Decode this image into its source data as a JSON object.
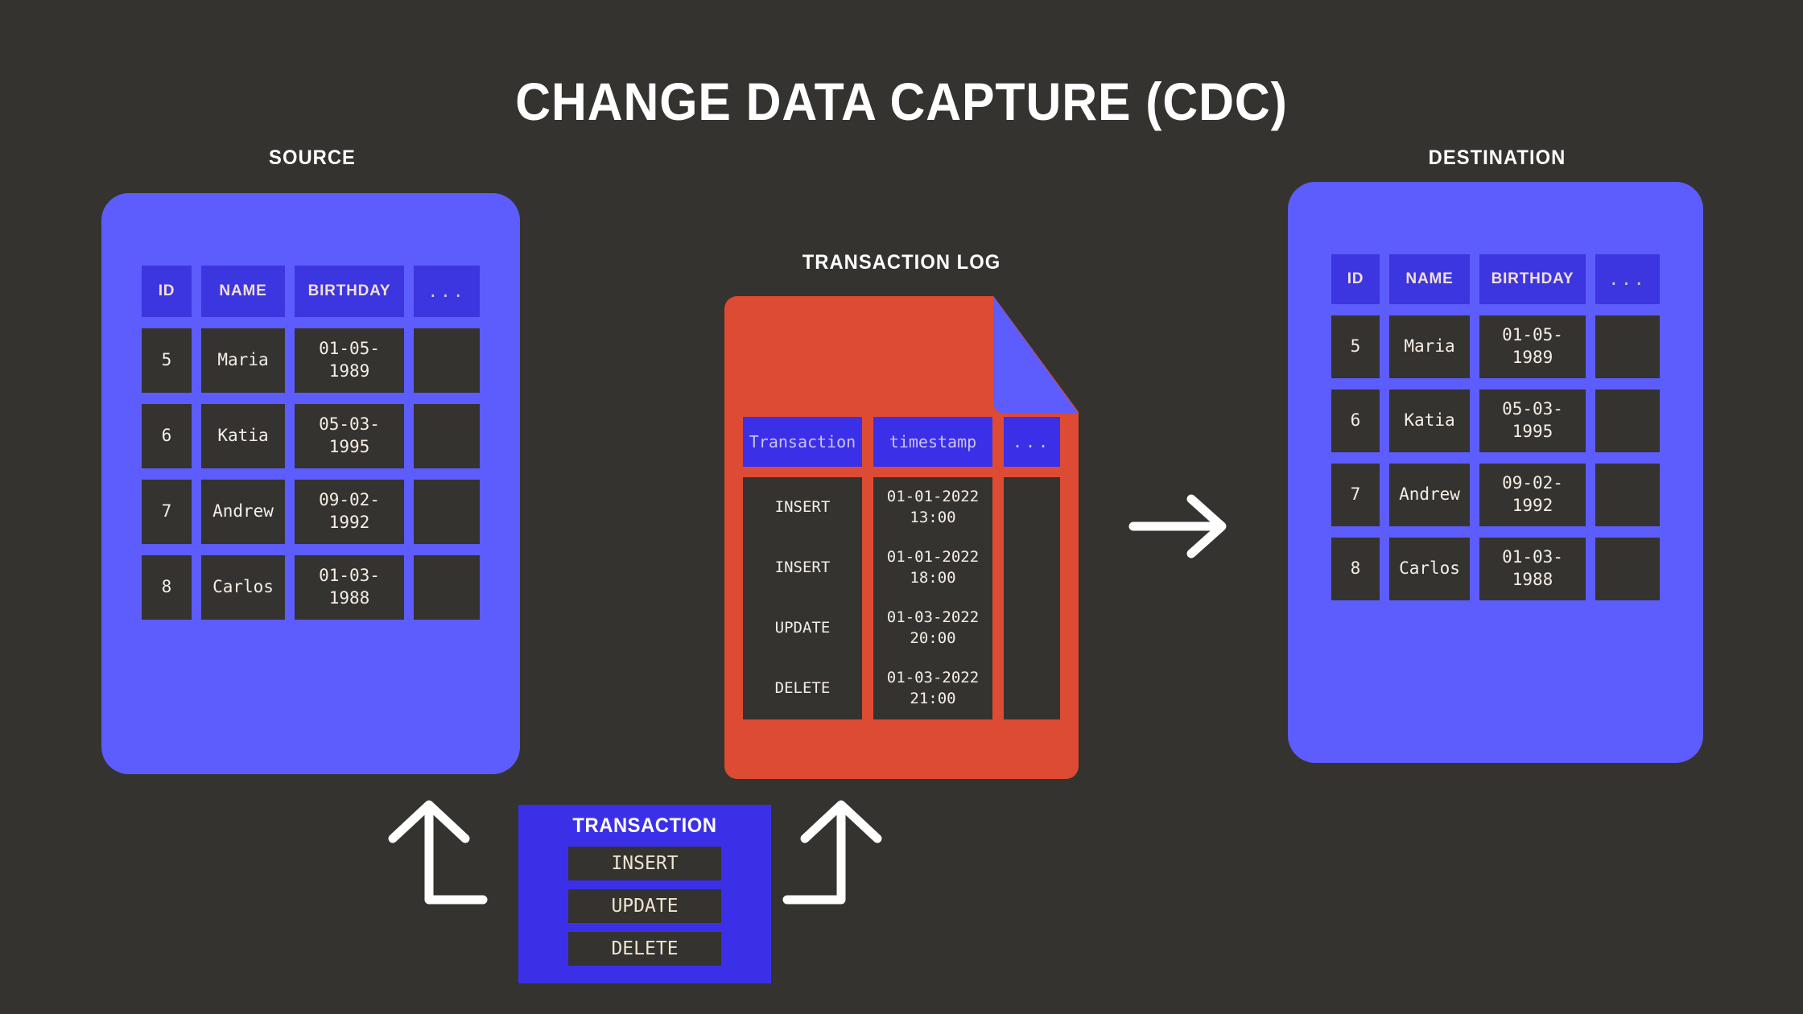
{
  "title": "CHANGE DATA CAPTURE (CDC)",
  "captions": {
    "source": "SOURCE",
    "destination": "DESTINATION",
    "log": "TRANSACTION LOG"
  },
  "db_table": {
    "headers": [
      "ID",
      "NAME",
      "BIRTHDAY",
      "..."
    ],
    "rows": [
      [
        "5",
        "Maria",
        "01-05-\n1989",
        ""
      ],
      [
        "6",
        "Katia",
        "05-03-\n1995",
        ""
      ],
      [
        "7",
        "Andrew",
        "09-02-\n1992",
        ""
      ],
      [
        "8",
        "Carlos",
        "01-03-\n1988",
        ""
      ]
    ]
  },
  "log_table": {
    "headers": [
      "Transaction",
      "timestamp",
      "..."
    ],
    "rows": [
      [
        "INSERT",
        "01-01-2022\n13:00",
        ""
      ],
      [
        "INSERT",
        "01-01-2022\n18:00",
        ""
      ],
      [
        "UPDATE",
        "01-03-2022\n20:00",
        ""
      ],
      [
        "DELETE",
        "01-03-2022\n21:00",
        ""
      ]
    ]
  },
  "transaction_panel": {
    "title": "TRANSACTION",
    "buttons": [
      "INSERT",
      "UPDATE",
      "DELETE"
    ]
  },
  "colors": {
    "background": "#34332f",
    "card_purple": "#5d5cfd",
    "header_blue": "#3b36e0",
    "panel_blue": "#3b30e8",
    "log_red": "#dd4b34",
    "cell_dark": "#34332f",
    "text_cream": "#f6eee6",
    "header_text": "#f2dfd0",
    "white": "#ffffff"
  }
}
